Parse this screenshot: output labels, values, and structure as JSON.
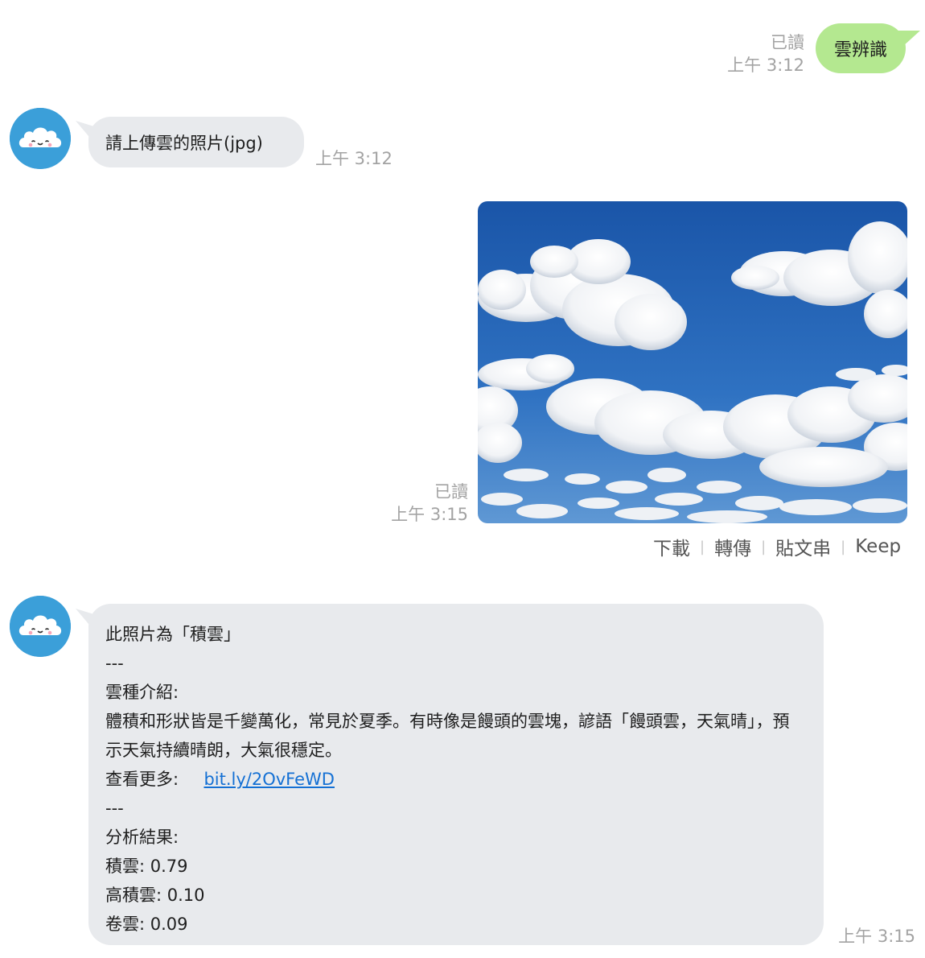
{
  "outgoing_1": {
    "text": "雲辨識",
    "read": "已讀",
    "time": "上午 3:12"
  },
  "incoming_1": {
    "text": "請上傳雲的照片(jpg)",
    "time": "上午 3:12"
  },
  "photo_message": {
    "read": "已讀",
    "time": "上午 3:15",
    "actions": [
      "下載",
      "轉傳",
      "貼文串",
      "Keep"
    ]
  },
  "incoming_2": {
    "time": "上午 3:15",
    "lines": {
      "result_title": "此照片為「積雲」",
      "divider_1": "---",
      "intro_label": "雲種介紹:",
      "intro_text": "體積和形狀皆是千變萬化，常見於夏季。有時像是饅頭的雲塊，諺語「饅頭雲，天氣晴」，預示天氣持續晴朗，大氣很穩定。",
      "more_label": "查看更多:",
      "more_link": "bit.ly/2OvFeWD",
      "divider_2": "---",
      "analysis_label": "分析結果:",
      "score_1": "積雲: 0.79",
      "score_2": "高積雲: 0.10",
      "score_3": "卷雲: 0.09"
    }
  },
  "colors": {
    "outgoing_bubble": "#b4e890",
    "incoming_bubble": "#e8eaed",
    "avatar_bg": "#3b9fd9",
    "link": "#1470d4",
    "meta": "#a3a3a3"
  }
}
